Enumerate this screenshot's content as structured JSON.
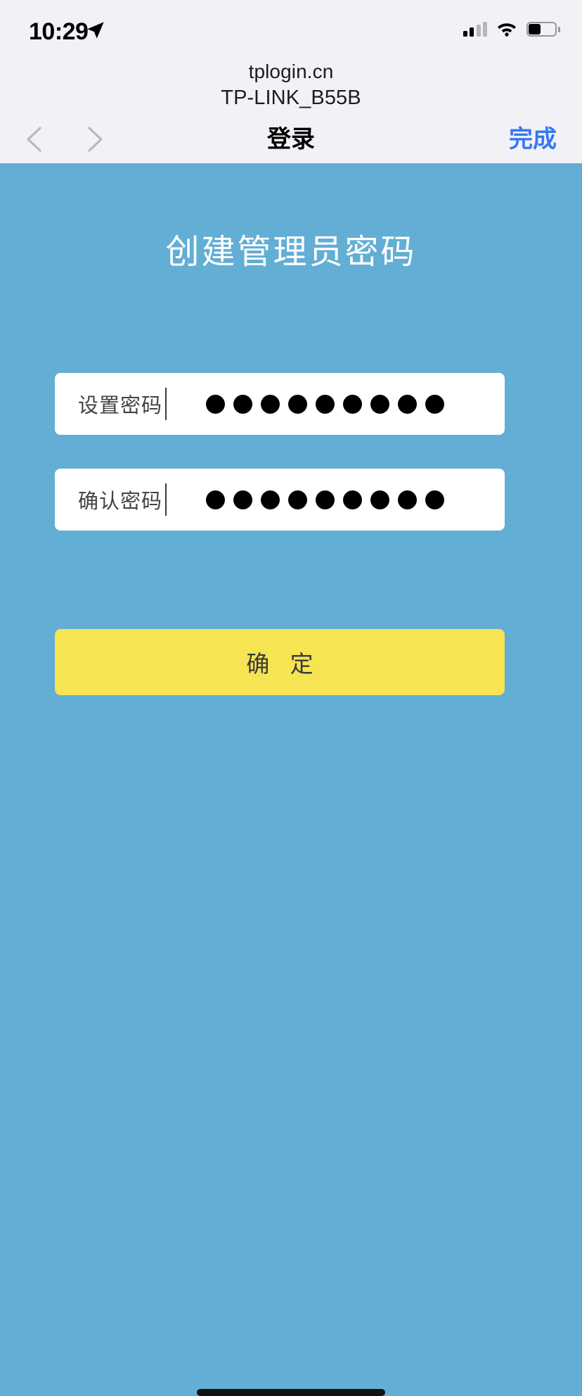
{
  "status_bar": {
    "time": "10:29",
    "location_icon": "location-arrow-icon",
    "cellular_icon": "cellular-signal-icon",
    "cellular_bars_filled": 2,
    "cellular_bars_total": 4,
    "wifi_icon": "wifi-icon",
    "battery_icon": "battery-icon",
    "battery_percent": 45
  },
  "browser": {
    "url": "tplogin.cn",
    "ssid": "TP-LINK_B55B",
    "back_icon": "chevron-left-icon",
    "forward_icon": "chevron-right-icon",
    "title": "登录",
    "done_label": "完成",
    "done_color": "#3478F6"
  },
  "page": {
    "background_color": "#63AED4",
    "heading": "创建管理员密码",
    "fields": [
      {
        "name": "password",
        "label": "设置密码",
        "value_masked": "●●●●●●●●●",
        "dot_count": 9
      },
      {
        "name": "confirm-password",
        "label": "确认密码",
        "value_masked": "●●●●●●●●●",
        "dot_count": 9
      }
    ],
    "submit_label": "确 定",
    "submit_color": "#F6E452"
  },
  "home_indicator": "home-indicator"
}
